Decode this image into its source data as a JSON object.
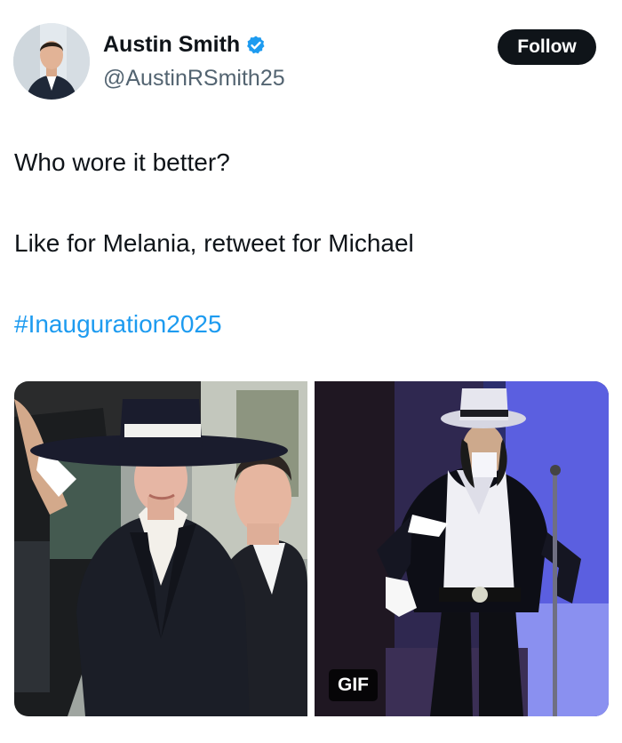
{
  "author": {
    "name": "Austin Smith",
    "handle": "@AustinRSmith25",
    "verified_icon": "verified-badge-icon",
    "verified_color": "#1d9bf0"
  },
  "follow_label": "Follow",
  "tweet": {
    "line1": "Who wore it better?",
    "line2": "Like for Melania, retweet for Michael",
    "hashtag": "#Inauguration2025",
    "hashtag_color": "#1d9bf0"
  },
  "media": {
    "gif_label": "GIF"
  }
}
